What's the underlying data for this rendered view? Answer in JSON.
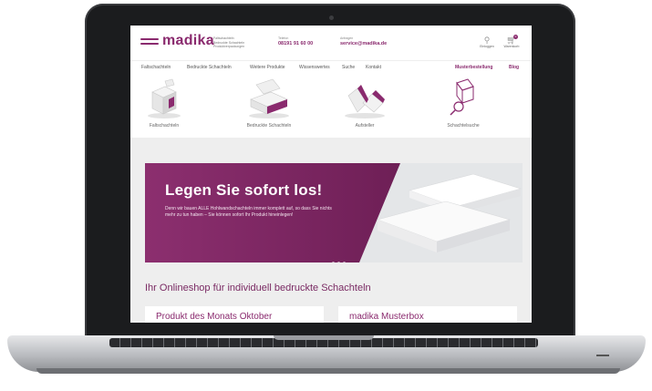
{
  "brand": {
    "name": "madika",
    "tagline": [
      "Faltschachteln",
      "Bedruckte Schachteln",
      "Produktverpackungen"
    ],
    "color": "#8a2a6e"
  },
  "header": {
    "phone_label": "Telefon",
    "phone": "08191 91 60 00",
    "email_label": "Anfragen",
    "email": "service@madika.de",
    "account_label": "Einloggen",
    "cart_label": "Warenkorb",
    "cart_count": "0"
  },
  "nav": {
    "items": [
      "Faltschachteln",
      "Bedruckte Schachteln",
      "Weitere Produkte",
      "Wissenswertes",
      "Suche",
      "Kontakt"
    ],
    "right": [
      "Musterbestellung",
      "Blog"
    ]
  },
  "categories": [
    {
      "label": "Faltschachteln",
      "icon": "box-icon"
    },
    {
      "label": "Bedruckte Schachteln",
      "icon": "printed-box-icon"
    },
    {
      "label": "Aufsteller",
      "icon": "display-stand-icon"
    },
    {
      "label": "Schachtelsuche",
      "icon": "box-search-icon"
    }
  ],
  "banner": {
    "title": "Legen Sie sofort los!",
    "text": "Denn wir bauen ALLE Hohlwandschachteln immer komplett auf, so dass Sie nichts mehr zu tun haben – Sie können sofort Ihr Produkt hineinlegen!",
    "slides": 3
  },
  "shop_title": "Ihr Onlineshop für individuell bedruckte Schachteln",
  "cards": [
    "Produkt des Monats Oktober",
    "madika Musterbox"
  ]
}
